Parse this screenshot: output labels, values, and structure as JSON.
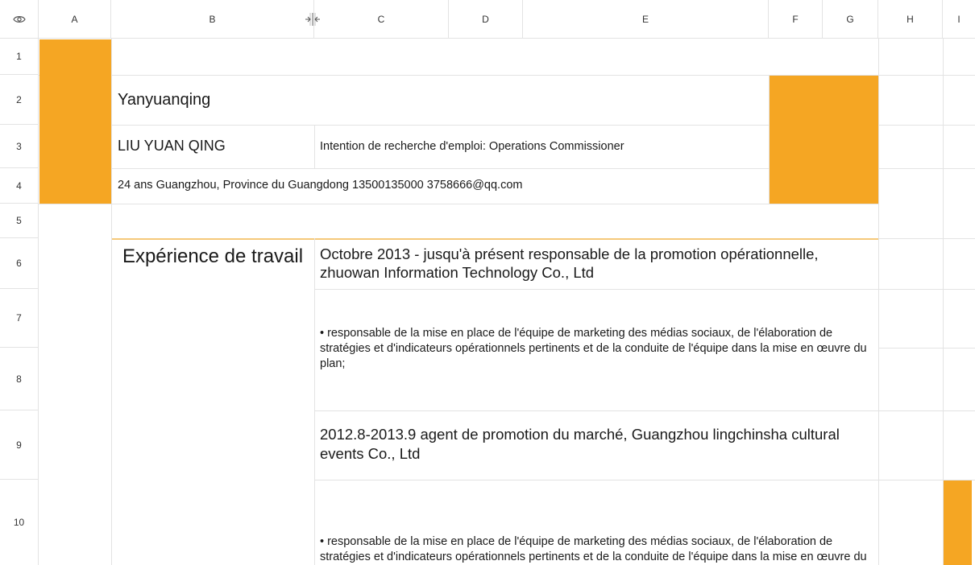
{
  "columns": [
    "A",
    "B",
    "C",
    "D",
    "E",
    "F",
    "G",
    "H",
    "I"
  ],
  "rows": [
    "1",
    "2",
    "3",
    "4",
    "5",
    "6",
    "7",
    "8",
    "9",
    "10"
  ],
  "accent_color": "#f5a623",
  "resume": {
    "name_pinyin": "Yanyuanqing",
    "name_upper": "LIU YUAN QING",
    "job_intention": "Intention de recherche d'emploi: Operations Commissioner",
    "contact_line": "24 ans Guangzhou, Province du Guangdong 13500135000 3758666@qq.com",
    "section_title": "Expérience de travail",
    "jobs": [
      {
        "title": "Octobre 2013 - jusqu'à présent responsable de la promotion opérationnelle, zhuowan Information Technology Co., Ltd",
        "description": "• responsable de la mise en place de l'équipe de marketing des médias sociaux, de l'élaboration de stratégies et d'indicateurs opérationnels pertinents et de la conduite de l'équipe dans la mise en œuvre du plan;"
      },
      {
        "title": "2012.8-2013.9 agent de promotion du marché, Guangzhou lingchinsha cultural events Co., Ltd",
        "description": "• responsable de la mise en place de l'équipe de marketing des médias sociaux, de l'élaboration de stratégies et d'indicateurs opérationnels pertinents et de la conduite de l'équipe dans la mise en œuvre du plan;"
      }
    ]
  }
}
